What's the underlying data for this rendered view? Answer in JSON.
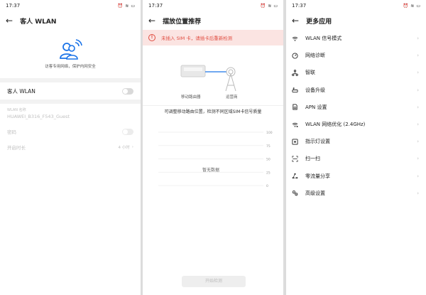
{
  "status_bar": {
    "time": "17:37"
  },
  "screen1": {
    "title": "客人 WLAN",
    "hero_caption": "访客专用网络，保护内网安全",
    "wlan_toggle_label": "客人 WLAN",
    "wlan_name_label": "WLAN 名称",
    "wlan_name_value": "HUAWEI_B316_F543_Guest",
    "password_label": "密码",
    "duration_label": "开启时长",
    "duration_value": "4 小时"
  },
  "screen2": {
    "title": "摆放位置推荐",
    "alert_text": "未插入 SIM 卡，请插卡后重新检测",
    "router_label": "移动路由器",
    "operator_label": "运营商",
    "note": "可调整移动路由位置，检测不同区域SIM卡信号质量",
    "chart_data": {
      "type": "line",
      "y_ticks": [
        "100",
        "75",
        "50",
        "25",
        "0"
      ],
      "empty_label": "暂无数据",
      "series": []
    },
    "start_button": "开始检测"
  },
  "screen3": {
    "title": "更多应用",
    "items": [
      {
        "label": "WLAN 信号模式",
        "icon": "wifi-icon"
      },
      {
        "label": "网络诊断",
        "icon": "diagnosis-icon"
      },
      {
        "label": "智联",
        "icon": "hilink-icon"
      },
      {
        "label": "设备升级",
        "icon": "upgrade-icon"
      },
      {
        "label": "APN 设置",
        "icon": "sim-icon"
      },
      {
        "label": "WLAN 网络优化 (2.4GHz)",
        "icon": "wifi-optimize-icon"
      },
      {
        "label": "指示灯设置",
        "icon": "indicator-light-icon"
      },
      {
        "label": "扫一扫",
        "icon": "scan-icon"
      },
      {
        "label": "零流量分享",
        "icon": "share-icon"
      },
      {
        "label": "高级设置",
        "icon": "advanced-settings-icon"
      }
    ]
  },
  "colors": {
    "accent": "#1a73e8",
    "alert_text": "#e04b3f",
    "alert_bg": "#fbe4e2"
  }
}
